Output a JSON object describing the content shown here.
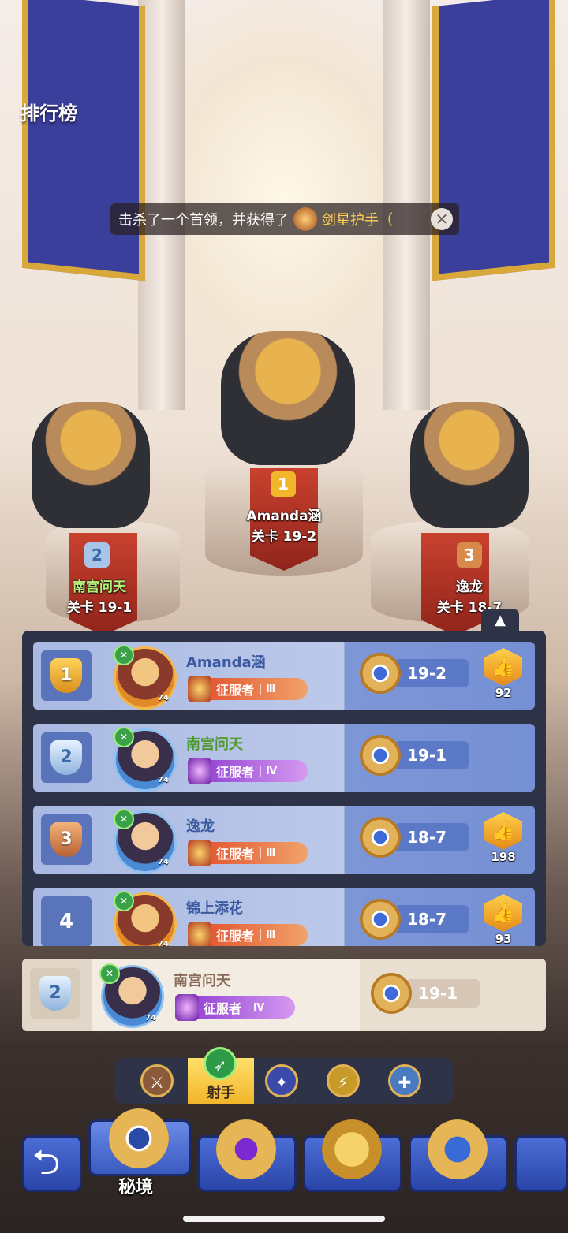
{
  "screen_title": "排行榜",
  "notice": {
    "text": "击杀了一个首领，并获得了",
    "item_name": "剑星护手（",
    "close": "✕"
  },
  "podium": {
    "first": {
      "rank": "1",
      "name": "Amanda涵",
      "stage": "关卡 19-2"
    },
    "second": {
      "rank": "2",
      "name": "南宫问天",
      "stage": "关卡 19-1"
    },
    "third": {
      "rank": "3",
      "name": "逸龙",
      "stage": "关卡 18-7"
    }
  },
  "collapse_icon": "▲",
  "leaderboard": [
    {
      "rank": "1",
      "name": "Amanda涵",
      "level": "74",
      "title": "征服者",
      "tier": "Ⅲ",
      "stage": "19-2",
      "likes": "92"
    },
    {
      "rank": "2",
      "name": "南宫问天",
      "level": "74",
      "title": "征服者",
      "tier": "Ⅳ",
      "stage": "19-1",
      "likes": ""
    },
    {
      "rank": "3",
      "name": "逸龙",
      "level": "74",
      "title": "征服者",
      "tier": "Ⅲ",
      "stage": "18-7",
      "likes": "198"
    },
    {
      "rank": "4",
      "name": "锦上添花",
      "level": "74",
      "title": "征服者",
      "tier": "Ⅲ",
      "stage": "18-7",
      "likes": "93"
    }
  ],
  "my_rank": {
    "rank": "2",
    "name": "南宫问天",
    "level": "74",
    "title": "征服者",
    "tier": "Ⅳ",
    "stage": "19-1"
  },
  "class_filters": {
    "items": [
      "warrior-axe-icon",
      "archer-bow-icon",
      "mage-staff-icon",
      "assassin-blade-icon",
      "priest-cross-icon"
    ],
    "active_label": "射手"
  },
  "bottom_nav": {
    "active_label": "秘境",
    "icons": [
      "back-arrow-icon",
      "secret-realm-icon",
      "purple-gem-icon",
      "crown-icon",
      "star-compass-icon"
    ]
  },
  "colors": {
    "accent_gold": "#e2b256",
    "panel_bg": "#2d3246",
    "row_blue": "#a9b9e2"
  }
}
